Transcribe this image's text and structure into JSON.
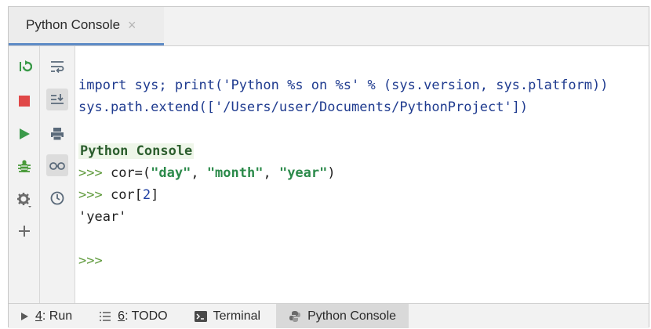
{
  "tab": {
    "title": "Python Console",
    "close_glyph": "×"
  },
  "toolbar_left": [
    {
      "name": "rerun-icon",
      "color": "#3b9a4a"
    },
    {
      "name": "stop-icon",
      "color": "#e04040"
    },
    {
      "name": "run-icon",
      "color": "#3b9a4a"
    },
    {
      "name": "debug-icon",
      "color": "#4a9a3a"
    },
    {
      "name": "settings-icon",
      "color": "#6b6b6b"
    },
    {
      "name": "add-icon",
      "color": "#6b6b6b"
    }
  ],
  "toolbar_right": [
    {
      "name": "soft-wrap-icon"
    },
    {
      "name": "scroll-to-end-icon"
    },
    {
      "name": "print-icon"
    },
    {
      "name": "show-variables-icon"
    },
    {
      "name": "history-icon"
    }
  ],
  "console": {
    "line1": "import sys; print('Python %s on %s' % (sys.version, sys.platform))",
    "line2": "sys.path.extend(['/Users/user/Documents/PythonProject'])",
    "header": "Python Console",
    "prompt": ">>>",
    "cmd1_pre": " cor=(",
    "cmd1_s1": "\"day\"",
    "cmd1_sep1": ", ",
    "cmd1_s2": "\"month\"",
    "cmd1_sep2": ", ",
    "cmd1_s3": "\"year\"",
    "cmd1_post": ")",
    "cmd2_pre": " cor[",
    "cmd2_idx": "2",
    "cmd2_post": "]",
    "output": "'year'"
  },
  "bottom": {
    "run_num": "4",
    "run_label": ": Run",
    "todo_num": "6",
    "todo_label": ": TODO",
    "terminal_label": "Terminal",
    "python_console_label": "Python Console"
  }
}
